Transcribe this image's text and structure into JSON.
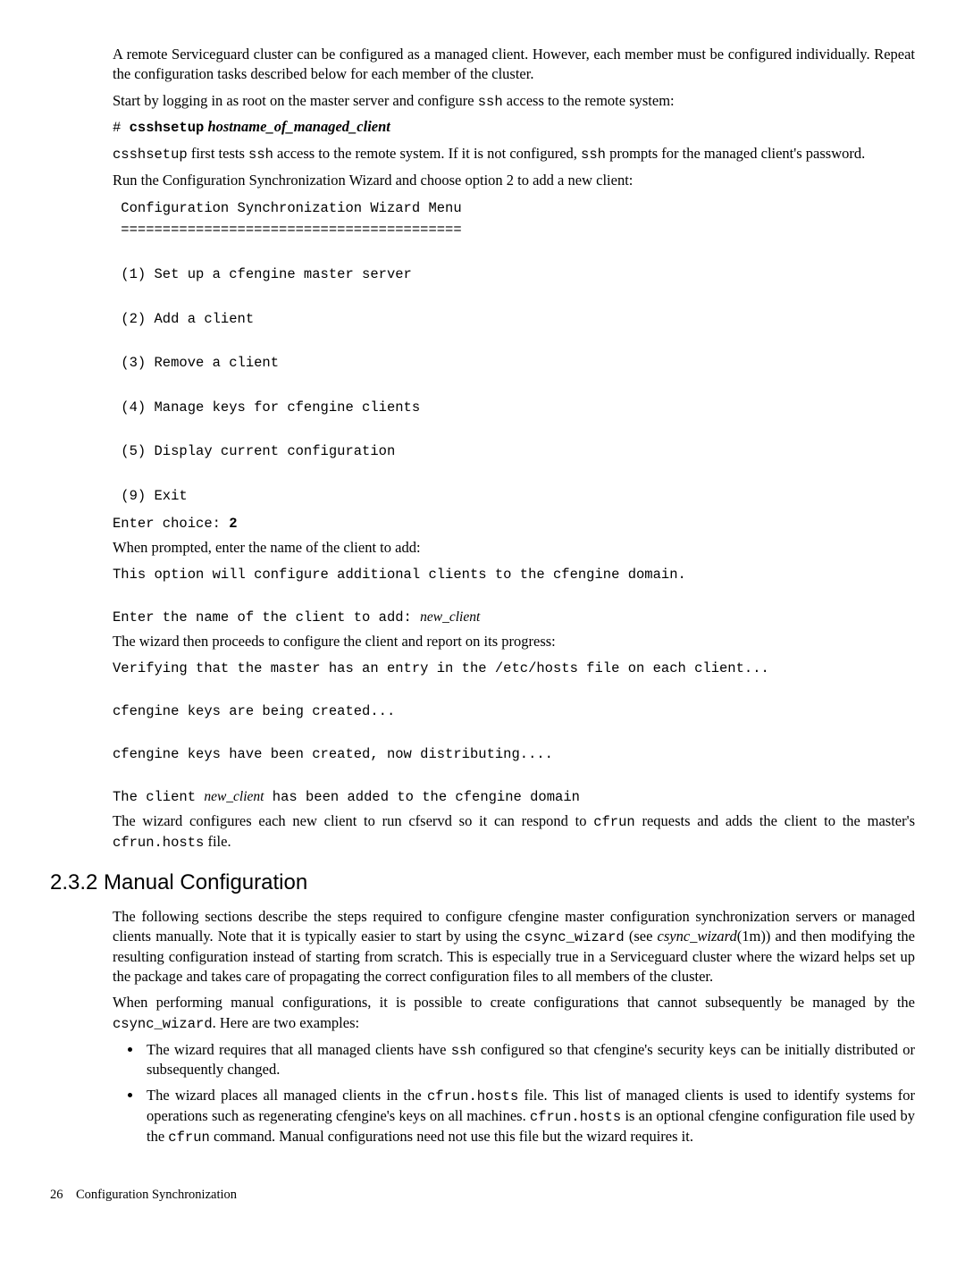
{
  "para1": "A remote Serviceguard cluster can be configured as a managed client. However, each member must be configured individually. Repeat the configuration tasks described below for each member of the cluster.",
  "para2_a": "Start by logging in as root on the master server and configure ",
  "para2_ssh": "ssh",
  "para2_b": " access to the remote system:",
  "cmd_hash": "# ",
  "cmd_bold": "csshsetup",
  "cmd_italic": " hostname_of_managed_client",
  "para3_a": "csshsetup",
  "para3_b": " first tests ",
  "para3_c": "ssh",
  "para3_d": " access to the remote system. If it is not configured, ",
  "para3_e": "ssh",
  "para3_f": " prompts for the managed client's password.",
  "para4": "Run the Configuration Synchronization Wizard and choose option 2 to add a new client:",
  "menu": " Configuration Synchronization Wizard Menu\n =========================================\n\n (1) Set up a cfengine master server\n\n (2) Add a client\n\n (3) Remove a client\n\n (4) Manage keys for cfengine clients\n\n (5) Display current configuration\n\n (9) Exit\n",
  "enter_choice_a": "Enter choice: ",
  "enter_choice_b": "2",
  "para5": "When prompted, enter the name of the client to add:",
  "out1": "This option will configure additional clients to the cfengine domain.\n\nEnter the name of the client to add: ",
  "out1_italic": "new_client",
  "para6": "The wizard then proceeds to configure the client and report on its progress:",
  "out2": "Verifying that the master has an entry in the /etc/hosts file on each client...\n\ncfengine keys are being created...\n\ncfengine keys have been created, now distributing....\n\nThe client ",
  "out2_italic": "new_client",
  "out2_b": " has been added to the cfengine domain",
  "para7_a": "The wizard configures each new client to run cfservd so it can respond to ",
  "para7_cfrun": "cfrun",
  "para7_b": " requests and adds the client to the master's ",
  "para7_file": "cfrun.hosts",
  "para7_c": " file.",
  "h2": "2.3.2 Manual Configuration",
  "mc1_a": "The following sections describe the steps required to configure cfengine master configuration synchronization servers or managed clients manually. Note that it is typically easier to start by using the ",
  "mc1_code1": "csync_wizard",
  "mc1_b": " (see ",
  "mc1_italic": "csync_wizard",
  "mc1_c": "(1m)) and then modifying the resulting configuration instead of starting from scratch. This is especially true in a Serviceguard cluster where the wizard helps set up the package and takes care of propagating the correct configuration files to all members of the cluster.",
  "mc2_a": "When performing manual configurations, it is possible to create configurations that cannot subsequently be managed by the ",
  "mc2_code": "csync_wizard",
  "mc2_b": ". Here are two examples:",
  "b1_a": "The wizard requires that all managed clients have ",
  "b1_code": "ssh",
  "b1_b": " configured so that cfengine's security keys can be initially distributed or subsequently changed.",
  "b2_a": "The wizard places all managed clients in the ",
  "b2_code1": "cfrun.hosts",
  "b2_b": " file. This list of managed clients is used to identify systems for operations such as regenerating cfengine's keys on all machines. ",
  "b2_code2": "cfrun.hosts",
  "b2_c": " is an optional cfengine configuration file used by the ",
  "b2_code3": "cfrun",
  "b2_d": " command. Manual configurations need not use this file but the wizard requires it.",
  "footer_page": "26",
  "footer_text": "Configuration Synchronization"
}
